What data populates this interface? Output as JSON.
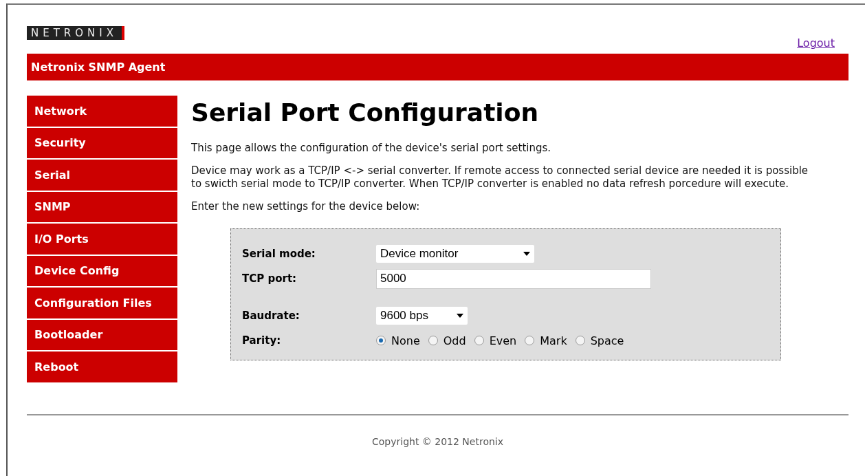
{
  "logo": "NETRONIX",
  "logout": "Logout",
  "header": {
    "title": "Netronix SNMP Agent"
  },
  "sidebar": {
    "items": [
      {
        "label": "Network",
        "selected": false
      },
      {
        "label": "Security",
        "selected": false
      },
      {
        "label": "Serial",
        "selected": false
      },
      {
        "label": "SNMP",
        "selected": false
      },
      {
        "label": "I/O Ports",
        "selected": false
      },
      {
        "label": "Device Config",
        "selected": false
      },
      {
        "label": "Configuration Files",
        "selected": false
      },
      {
        "label": "Bootloader",
        "selected": false
      },
      {
        "label": "Reboot",
        "selected": false
      }
    ]
  },
  "page": {
    "title": "Serial Port Configuration",
    "paragraphs": [
      "This page allows the configuration of the device's serial port settings.",
      "Device may work as a TCP/IP <-> serial converter. If remote access to connected serial device are needed it is possible to swicth serial mode to TCP/IP converter. When TCP/IP converter is enabled no data refresh porcedure will execute.",
      "Enter the new settings for the device below:"
    ]
  },
  "form": {
    "fields": [
      {
        "kind": "select",
        "label": "Serial mode:",
        "value": "Device monitor"
      },
      {
        "kind": "text",
        "label": "TCP port:",
        "value": "5000"
      },
      {
        "kind": "gap"
      },
      {
        "kind": "select",
        "label": "Baudrate:",
        "value": "9600 bps"
      },
      {
        "kind": "radio",
        "label": "Parity:",
        "options": [
          {
            "label": "None",
            "selected": true
          },
          {
            "label": "Odd",
            "selected": false
          },
          {
            "label": "Even",
            "selected": false
          },
          {
            "label": "Mark",
            "selected": false
          },
          {
            "label": "Space",
            "selected": false
          }
        ]
      }
    ]
  },
  "footer": {
    "copyright": "Copyright © 2012 Netronix"
  }
}
